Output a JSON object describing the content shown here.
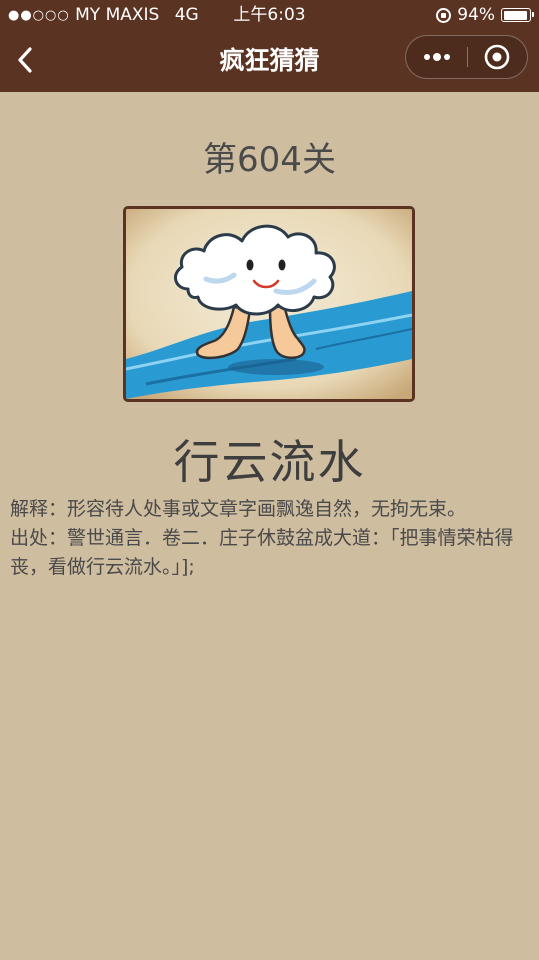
{
  "status_bar": {
    "carrier": "MY MAXIS",
    "network": "4G",
    "time": "上午6:03",
    "battery": "94%",
    "battery_level": 0.94
  },
  "nav": {
    "title": "疯狂猜猜",
    "back_icon": "chevron-left-icon",
    "more_icon": "more-dots-icon",
    "close_icon": "target-close-icon"
  },
  "level": {
    "title": "第604关"
  },
  "answer": "行云流水",
  "explanation_text": "解释：形容待人处事或文章字画飘逸自然，无拘无束。",
  "source_text": "出处：警世通言．卷二．庄子休鼓盆成大道：「把事情荣枯得丧，看做行云流水。」];",
  "colors": {
    "header_bg": "#5b3323",
    "page_bg": "#cfbda0",
    "text": "#4a4a4a"
  }
}
